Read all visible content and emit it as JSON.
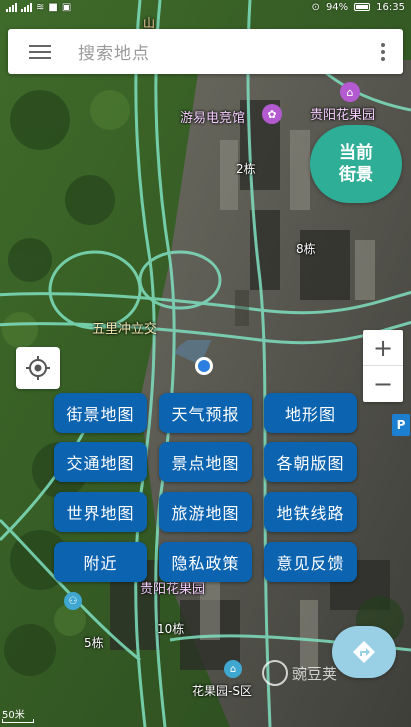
{
  "status_bar": {
    "time": "16:35",
    "battery": "94%"
  },
  "search": {
    "placeholder": "搜索地点"
  },
  "street_view_button": {
    "line1": "当前",
    "line2": "街景"
  },
  "zoom": {
    "in_label": "+",
    "out_label": "−"
  },
  "map_labels": {
    "game_hall": "游易电竞馆",
    "flower_park_top": "贵阳花果园",
    "building_2": "2栋",
    "building_8": "8栋",
    "interchange": "五里冲立交",
    "flower_park_bottom": "贵阳花果园",
    "building_10": "10栋",
    "building_5": "5栋",
    "flower_park_s": "花果园-S区",
    "mountain": "山"
  },
  "buttons": [
    {
      "label": "街景地图"
    },
    {
      "label": "天气预报"
    },
    {
      "label": "地形图"
    },
    {
      "label": "交通地图"
    },
    {
      "label": "景点地图"
    },
    {
      "label": "各朝版图"
    },
    {
      "label": "世界地图"
    },
    {
      "label": "旅游地图"
    },
    {
      "label": "地铁线路"
    },
    {
      "label": "附近"
    },
    {
      "label": "隐私政策"
    },
    {
      "label": "意见反馈"
    }
  ],
  "scale": "50米",
  "watermark": "豌豆荚",
  "colors": {
    "button_blue": "#0c63b0",
    "street_view_green": "#2fae97",
    "road": "#7fe0c0"
  }
}
